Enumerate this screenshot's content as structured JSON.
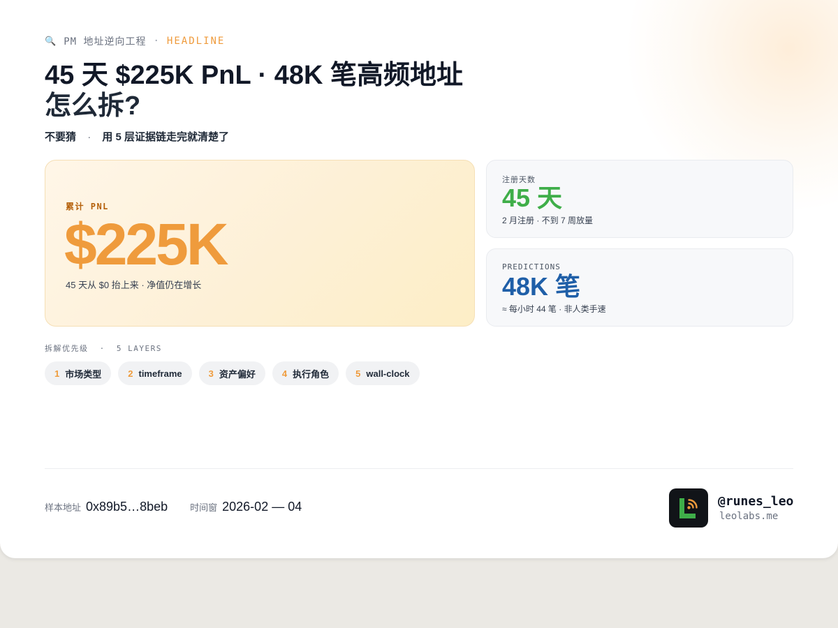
{
  "header": {
    "eyebrow_icon": "🔍",
    "eyebrow_text": "PM 地址逆向工程",
    "eyebrow_sep": "·",
    "eyebrow_tag": "HEADLINE",
    "title_line1": "45 天 $225K PnL · 48K 笔高频地址",
    "title_line2": "怎么拆?",
    "subtitle_left": "不要猜",
    "subtitle_sep": "·",
    "subtitle_right": "用 5 层证据链走完就清楚了"
  },
  "pnl_card": {
    "label": "累计 PNL",
    "value": "$225K",
    "note": "45 天从 $0 抬上来 · 净值仍在增长",
    "color": "#ef9b3c"
  },
  "stats": [
    {
      "label": "注册天数",
      "value": "45 天",
      "note": "2 月注册 · 不到 7 周放量",
      "color": "#3fae49"
    },
    {
      "label": "PREDICTIONS",
      "value": "48K 笔",
      "note": "≈ 每小时 44 笔 · 非人类手速",
      "color": "#1f5fa8"
    }
  ],
  "layers": {
    "label": "拆解优先级",
    "sep": "·",
    "count_label": "5 LAYERS",
    "items": [
      {
        "num": "1",
        "label": "市场类型"
      },
      {
        "num": "2",
        "label": "timeframe"
      },
      {
        "num": "3",
        "label": "资产偏好"
      },
      {
        "num": "4",
        "label": "执行角色"
      },
      {
        "num": "5",
        "label": "wall-clock"
      }
    ]
  },
  "footer": {
    "sample_key": "样本地址",
    "sample_value": "0x89b5…8beb",
    "window_key": "时间窗",
    "window_value": "2026-02 — 04",
    "logo_icon": "leolabs-logo-icon",
    "handle": "@runes_leo",
    "site": "leolabs.me"
  },
  "colors": {
    "accent": "#ef9b3c",
    "green": "#3fae49",
    "blue": "#1f5fa8"
  }
}
